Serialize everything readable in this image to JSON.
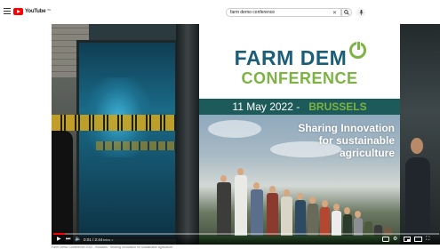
{
  "header": {
    "logo_text": "YouTube",
    "logo_region": "BE",
    "search_value": "farm demo conference",
    "search_placeholder": "Search"
  },
  "banner": {
    "title_line1": "FARM DEM",
    "title_line2": "CONFERENCE",
    "date": "11 May 2022 -",
    "city": "BRUSSELS",
    "tagline_1": "Sharing Innovation",
    "tagline_2": "for sustainable",
    "tagline_3": "agriculture"
  },
  "player": {
    "time": "0:01 / 2:44",
    "chip": "Intro >",
    "progress": 0.03,
    "icons": {
      "play": "play-icon",
      "next": "next-icon",
      "volume": "volume-icon",
      "captions": "captions-icon",
      "settings": "settings-icon",
      "miniplayer": "miniplayer-icon",
      "theater": "theater-icon",
      "fullscreen": "fullscreen-icon"
    }
  },
  "caption": "Farm Demo Conference 2022 - Brussels · Sharing Innovation for sustainable agriculture"
}
